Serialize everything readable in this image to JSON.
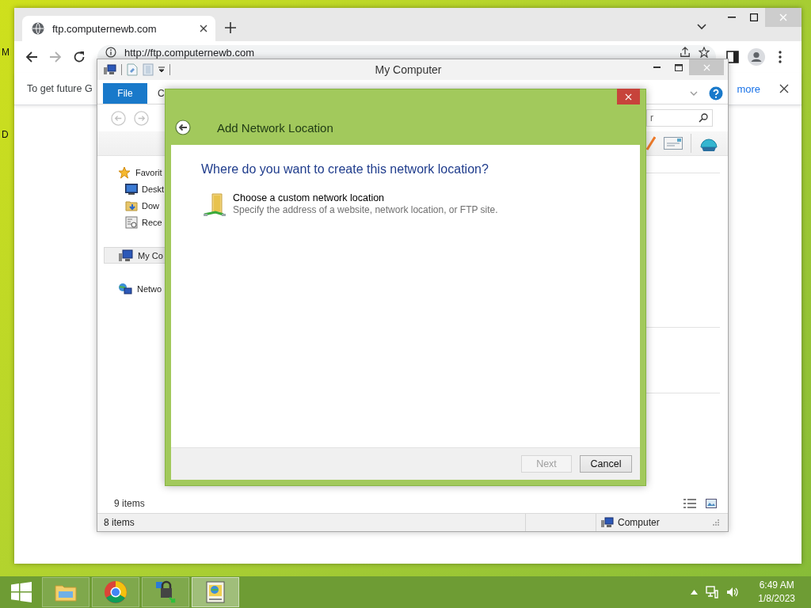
{
  "desktop": {
    "icon_labels": [
      "M",
      "D"
    ]
  },
  "browser": {
    "tab_title": "ftp.computernewb.com",
    "address": "http://ftp.computernewb.com",
    "infobar": {
      "message": "To get future G",
      "link": "more"
    }
  },
  "explorer": {
    "title": "My Computer",
    "ribbon_tabs": [
      {
        "label": "File",
        "selected": true
      },
      {
        "label": "C",
        "selected": false
      }
    ],
    "search": {
      "placeholder": "r"
    },
    "nav_items": [
      {
        "label": "Favorit",
        "selected": false,
        "children": [
          {
            "label": "Deskt",
            "selected": false
          },
          {
            "label": "Dow",
            "selected": false
          },
          {
            "label": "Rece",
            "selected": false
          }
        ]
      },
      {
        "label": "My Co",
        "selected": true
      },
      {
        "label": "Netwo",
        "selected": false
      }
    ],
    "item_count": "9 items",
    "status_bar": {
      "count": "8 items",
      "location": "Computer"
    }
  },
  "dialog": {
    "title": "Add Network Location",
    "heading": "Where do you want to create this network location?",
    "options": [
      {
        "title": "Choose a custom network location",
        "description": "Specify the address of a website, network location, or FTP site."
      }
    ],
    "buttons": [
      {
        "label": "Next",
        "disabled": true
      },
      {
        "label": "Cancel",
        "disabled": false
      }
    ]
  },
  "taskbar": {
    "apps": [
      {
        "selected": false
      },
      {
        "selected": false
      },
      {
        "selected": false
      },
      {
        "selected": true
      }
    ],
    "clock": {
      "time": "6:49 AM",
      "date": "1/8/2023"
    }
  }
}
